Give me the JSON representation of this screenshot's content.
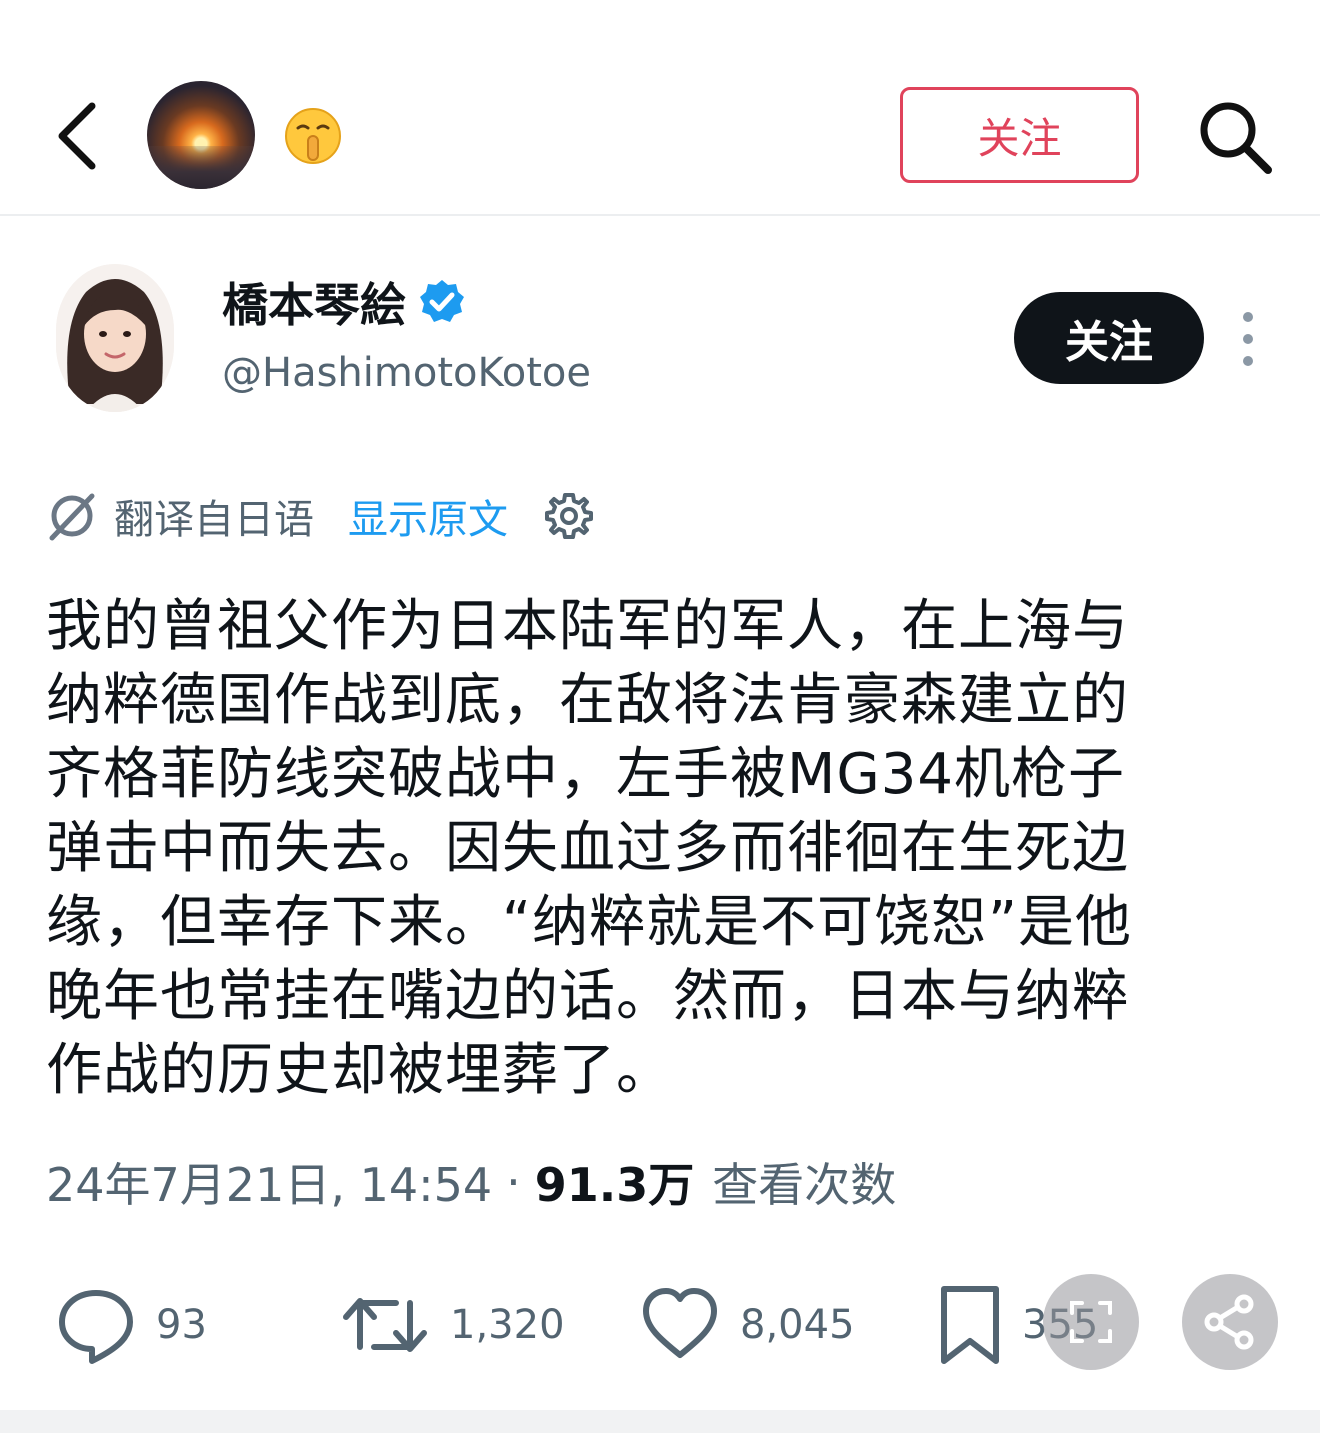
{
  "header": {
    "back_icon": "chevron-left-icon",
    "emoji": "🤫",
    "follow_label": "关注",
    "search_icon": "search-icon"
  },
  "tweet": {
    "author": {
      "name": "橋本琴絵",
      "handle": "@HashimotoKotoe",
      "verified": true
    },
    "follow_label": "关注",
    "translation": {
      "label": "翻译自日语",
      "show_original": "显示原文"
    },
    "text_lines": [
      "我的曾祖父作为日本陆军的军人，在上海与",
      "纳粹德国作战到底，在敌将法肯豪森建立的",
      "齐格菲防线突破战中，左手被MG34机枪子",
      "弹击中而失去。因失血过多而徘徊在生死边",
      "缘，但幸存下来。“纳粹就是不可饶恕”是他",
      "晚年也常挂在嘴边的话。然而，日本与纳粹",
      "作战的历史却被埋葬了。"
    ],
    "timestamp": "24年7月21日, 14:54",
    "views": "91.3万",
    "views_label": "查看次数",
    "stats": {
      "replies": "93",
      "retweets": "1,320",
      "likes": "8,045",
      "bookmarks": "355"
    }
  },
  "colors": {
    "accent_red": "#e0435b",
    "link_blue": "#1d9bf0",
    "text_primary": "#0f1419",
    "text_secondary": "#536471"
  }
}
